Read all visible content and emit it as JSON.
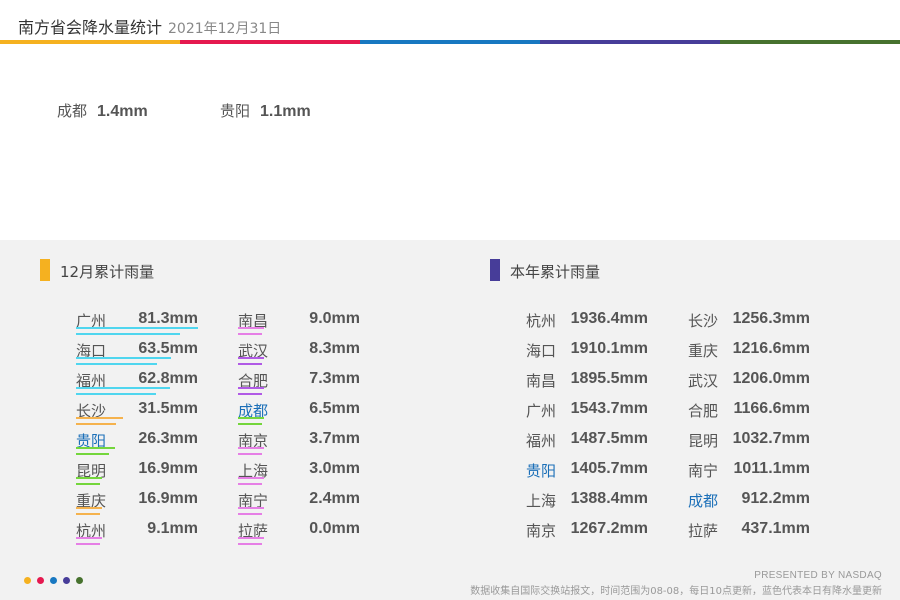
{
  "header": {
    "title": "南方省会降水量统计",
    "date": "2021年12月31日"
  },
  "palette": [
    "#f5b120",
    "#e5194f",
    "#1878c1",
    "#473d99",
    "#47722e"
  ],
  "today": [
    {
      "city": "成都",
      "value": "1.4mm"
    },
    {
      "city": "贵阳",
      "value": "1.1mm"
    }
  ],
  "monthly": {
    "title": "12月累计雨量",
    "accent": "#f5b120",
    "items": [
      {
        "city": "广州",
        "value": "81.3mm",
        "amount": 81.3,
        "color": "#4fd6ef",
        "highlight": false
      },
      {
        "city": "海口",
        "value": "63.5mm",
        "amount": 63.5,
        "color": "#4fd6ef",
        "highlight": false
      },
      {
        "city": "福州",
        "value": "62.8mm",
        "amount": 62.8,
        "color": "#4fd6ef",
        "highlight": false
      },
      {
        "city": "长沙",
        "value": "31.5mm",
        "amount": 31.5,
        "color": "#f5b24d",
        "highlight": false
      },
      {
        "city": "贵阳",
        "value": "26.3mm",
        "amount": 26.3,
        "color": "#74d63c",
        "highlight": true
      },
      {
        "city": "昆明",
        "value": "16.9mm",
        "amount": 16.9,
        "color": "#74d63c",
        "highlight": false
      },
      {
        "city": "重庆",
        "value": "16.9mm",
        "amount": 16.9,
        "color": "#f5b24d",
        "highlight": false
      },
      {
        "city": "杭州",
        "value": "9.1mm",
        "amount": 9.1,
        "color": "#e67fe6",
        "highlight": false
      },
      {
        "city": "南昌",
        "value": "9.0mm",
        "amount": 9.0,
        "color": "#e67fe6",
        "highlight": false
      },
      {
        "city": "武汉",
        "value": "8.3mm",
        "amount": 8.3,
        "color": "#b15ae6",
        "highlight": false
      },
      {
        "city": "合肥",
        "value": "7.3mm",
        "amount": 7.3,
        "color": "#b15ae6",
        "highlight": false
      },
      {
        "city": "成都",
        "value": "6.5mm",
        "amount": 6.5,
        "color": "#74d63c",
        "highlight": true
      },
      {
        "city": "南京",
        "value": "3.7mm",
        "amount": 3.7,
        "color": "#e67fe6",
        "highlight": false
      },
      {
        "city": "上海",
        "value": "3.0mm",
        "amount": 3.0,
        "color": "#e67fe6",
        "highlight": false
      },
      {
        "city": "南宁",
        "value": "2.4mm",
        "amount": 2.4,
        "color": "#e67fe6",
        "highlight": false
      },
      {
        "city": "拉萨",
        "value": "0.0mm",
        "amount": 0.0,
        "color": "#e67fe6",
        "highlight": false
      }
    ]
  },
  "yearly": {
    "title": "本年累计雨量",
    "accent": "#473d99",
    "items": [
      {
        "city": "杭州",
        "value": "1936.4mm",
        "highlight": false
      },
      {
        "city": "海口",
        "value": "1910.1mm",
        "highlight": false
      },
      {
        "city": "南昌",
        "value": "1895.5mm",
        "highlight": false
      },
      {
        "city": "广州",
        "value": "1543.7mm",
        "highlight": false
      },
      {
        "city": "福州",
        "value": "1487.5mm",
        "highlight": false
      },
      {
        "city": "贵阳",
        "value": "1405.7mm",
        "highlight": true
      },
      {
        "city": "上海",
        "value": "1388.4mm",
        "highlight": false
      },
      {
        "city": "南京",
        "value": "1267.2mm",
        "highlight": false
      },
      {
        "city": "长沙",
        "value": "1256.3mm",
        "highlight": false
      },
      {
        "city": "重庆",
        "value": "1216.6mm",
        "highlight": false
      },
      {
        "city": "武汉",
        "value": "1206.0mm",
        "highlight": false
      },
      {
        "city": "合肥",
        "value": "1166.6mm",
        "highlight": false
      },
      {
        "city": "昆明",
        "value": "1032.7mm",
        "highlight": false
      },
      {
        "city": "南宁",
        "value": "1011.1mm",
        "highlight": false
      },
      {
        "city": "成都",
        "value": "912.2mm",
        "highlight": true
      },
      {
        "city": "拉萨",
        "value": "437.1mm",
        "highlight": false
      }
    ]
  },
  "footer": {
    "presented": "PRESENTED BY NASDAQ",
    "note": "数据收集自国际交换站报文，时间范围为08-08，每日10点更新，蓝色代表本日有降水量更新"
  },
  "chart_data": {
    "type": "table",
    "title": "南方省会降水量统计",
    "date": "2021年12月31日",
    "today_rain_mm": {
      "成都": 1.4,
      "贵阳": 1.1
    },
    "monthly_total_mm": {
      "广州": 81.3,
      "海口": 63.5,
      "福州": 62.8,
      "长沙": 31.5,
      "贵阳": 26.3,
      "昆明": 16.9,
      "重庆": 16.9,
      "杭州": 9.1,
      "南昌": 9.0,
      "武汉": 8.3,
      "合肥": 7.3,
      "成都": 6.5,
      "南京": 3.7,
      "上海": 3.0,
      "南宁": 2.4,
      "拉萨": 0.0
    },
    "yearly_total_mm": {
      "杭州": 1936.4,
      "海口": 1910.1,
      "南昌": 1895.5,
      "广州": 1543.7,
      "福州": 1487.5,
      "贵阳": 1405.7,
      "上海": 1388.4,
      "南京": 1267.2,
      "长沙": 1256.3,
      "重庆": 1216.6,
      "武汉": 1206.0,
      "合肥": 1166.6,
      "昆明": 1032.7,
      "南宁": 1011.1,
      "成都": 912.2,
      "拉萨": 437.1
    }
  }
}
